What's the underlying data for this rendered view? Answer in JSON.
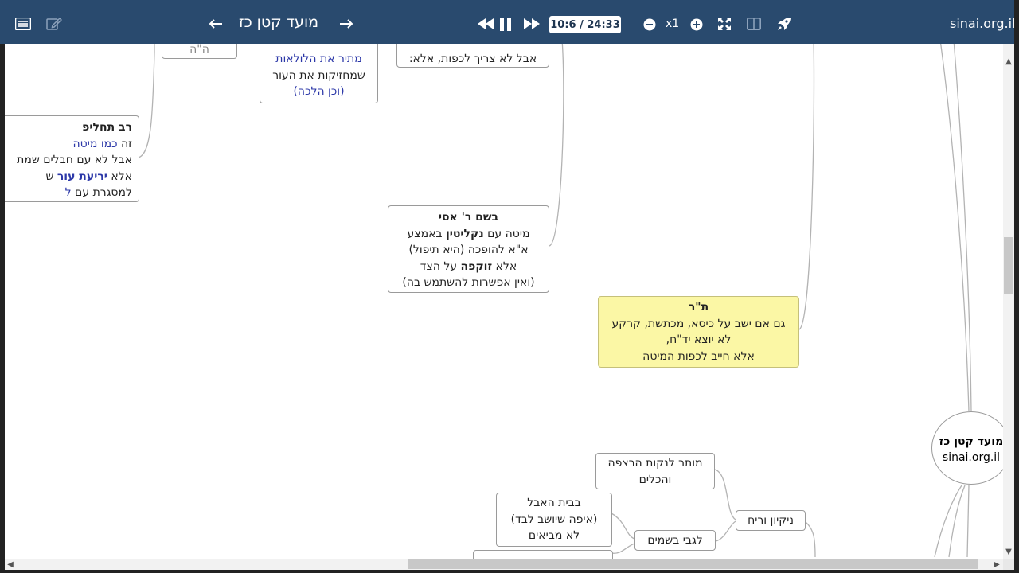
{
  "toolbar": {
    "title": "מועד קטן כז",
    "time": "10:6 / 24:33",
    "zoom": "x1",
    "brand": "sinai.org.il",
    "icons": [
      "list-icon",
      "edit-icon",
      "arrow-left-icon",
      "arrow-right-icon",
      "rewind-icon",
      "pause-icon",
      "fast-forward-icon",
      "zoom-out-icon",
      "zoom-in-icon",
      "fullscreen-icon",
      "split-view-icon",
      "rocket-icon"
    ]
  },
  "colors": {
    "toolbar_bg": "#294a6e",
    "node_border": "#9a9a9a",
    "highlight_bg": "#fbf7a5",
    "link_text": "#2c38a8"
  },
  "nodes": {
    "top_stub": {
      "text": "ה\"ה"
    },
    "hallaha": {
      "line1": "מתיר את הלולאות",
      "line2": "שמחזיקות את העור",
      "line3": "(וכן הלכה)"
    },
    "kfiya": {
      "line1": "אבל לא צריך לכפות, אלא:"
    },
    "rav": {
      "title": "רב תחליפ",
      "line2a": "זה ",
      "line2b": "כמו מיטה",
      "line3": "אבל לא עם חבלים שמת",
      "line4a": "אלא ",
      "line4b": "יריעת עור",
      "line4c": " ש",
      "line5a": "למסגרת עם ",
      "line5b": "ל"
    },
    "assi": {
      "title": "בשם ר' אסי",
      "line2a": "מיטה עם ",
      "line2b": "נקליטין",
      "line2c": "  באמצע",
      "line3": "א\"א להופכה (היא תיפול)",
      "line4a": "אלא ",
      "line4b": "זוקפה",
      "line4c": " על הצד",
      "line5": "(ואין אפשרות להשתמש בה)"
    },
    "taniya": {
      "title": "ת\"ר",
      "line2": "גם אם ישב על כיסא, מכתשת, קרקע",
      "line3": "לא יוצא יד\"ח,",
      "line4": "אלא חייב לכפות המיטה"
    },
    "mutar": {
      "line1": "מותר לנקות הרצפה",
      "line2": "והכלים"
    },
    "nikayon": {
      "line1": "ניקיון וריח"
    },
    "besamim": {
      "line1": "לגבי בשמים"
    },
    "beit_avel": {
      "line1": "בבית האבל",
      "line2": "(איפה שיושב לבד)",
      "line3": "לא מביאים"
    },
    "root": {
      "line1": "מועד קטן כז",
      "line2": "sinai.org.il"
    }
  }
}
